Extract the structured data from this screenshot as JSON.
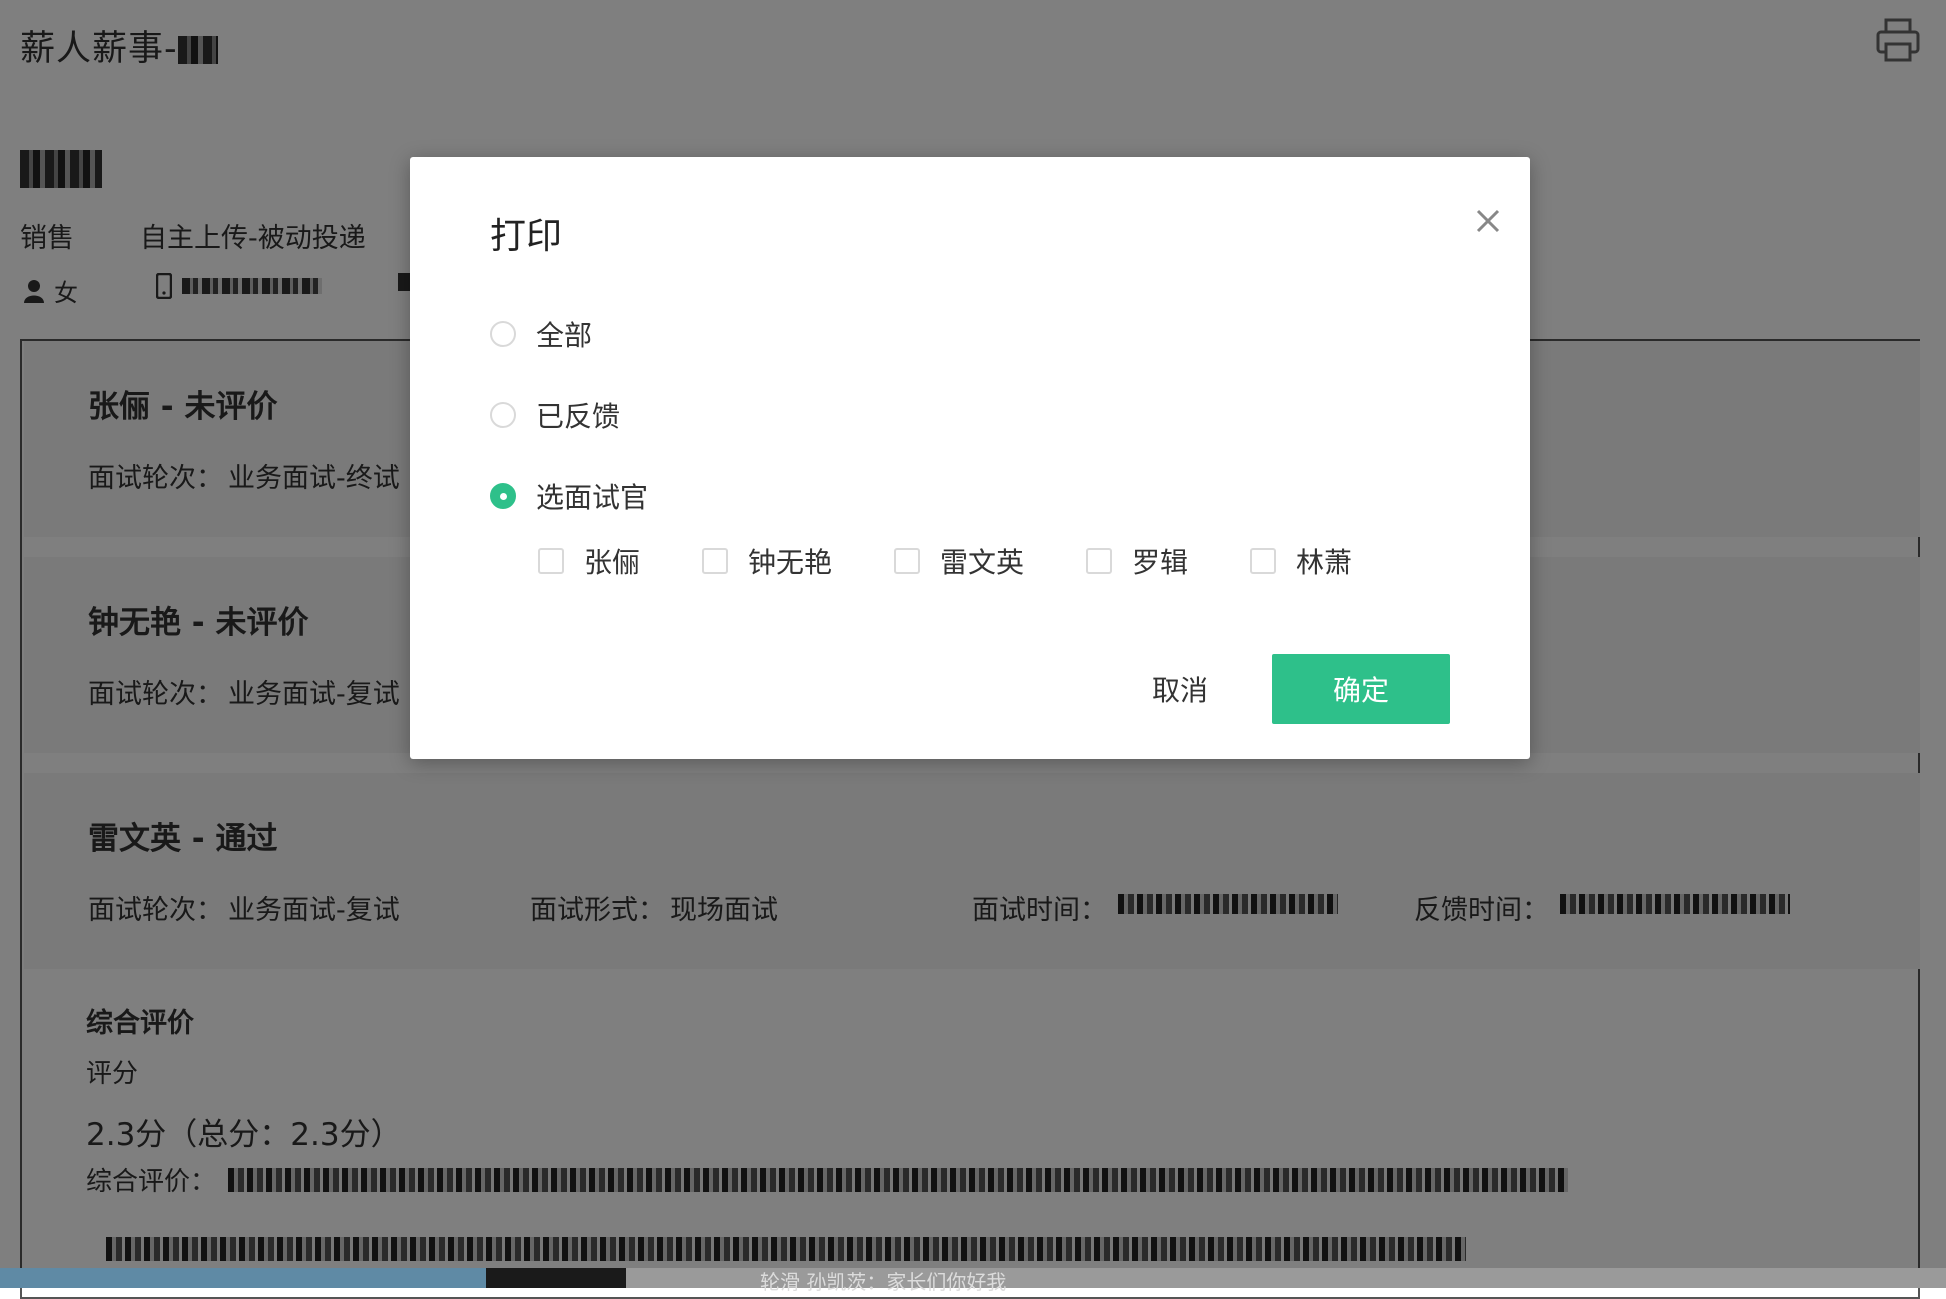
{
  "header": {
    "app_title": "薪人薪事-",
    "print_icon": "printer-icon"
  },
  "candidate": {
    "department": "销售",
    "source": "自主上传-被动投递",
    "gender_icon": "user-icon",
    "gender": "女",
    "phone_icon": "mobile-phone-icon",
    "email_icon": "mail-icon"
  },
  "interviews": [
    {
      "title": "张俪 - 未评价",
      "round_label": "面试轮次：",
      "round_value": "业务面试-终试"
    },
    {
      "title": "钟无艳 - 未评价",
      "round_label": "面试轮次：",
      "round_value": "业务面试-复试"
    },
    {
      "title": "雷文英 - 通过",
      "round_label": "面试轮次：",
      "round_value": "业务面试-复试",
      "form_label": "面试形式：",
      "form_value": "现场面试",
      "time_label": "面试时间：",
      "feedback_label": "反馈时间："
    }
  ],
  "summary": {
    "heading": "综合评价",
    "score_label": "评分",
    "score": "2.3分（总分：2.3分）",
    "evaluation_label": "综合评价："
  },
  "taskbar": {
    "ticker": "轮滑 孙凯茨：家长们你好我"
  },
  "modal": {
    "title": "打印",
    "close_icon": "close-icon",
    "options": [
      {
        "label": "全部",
        "checked": false
      },
      {
        "label": "已反馈",
        "checked": false
      },
      {
        "label": "选面试官",
        "checked": true
      }
    ],
    "interviewers": [
      "张俪",
      "钟无艳",
      "雷文英",
      "罗辑",
      "林萧"
    ],
    "cancel_label": "取消",
    "confirm_label": "确定"
  },
  "colors": {
    "accent": "#2ec08a",
    "overlay": "rgba(0,0,0,0.5)"
  }
}
